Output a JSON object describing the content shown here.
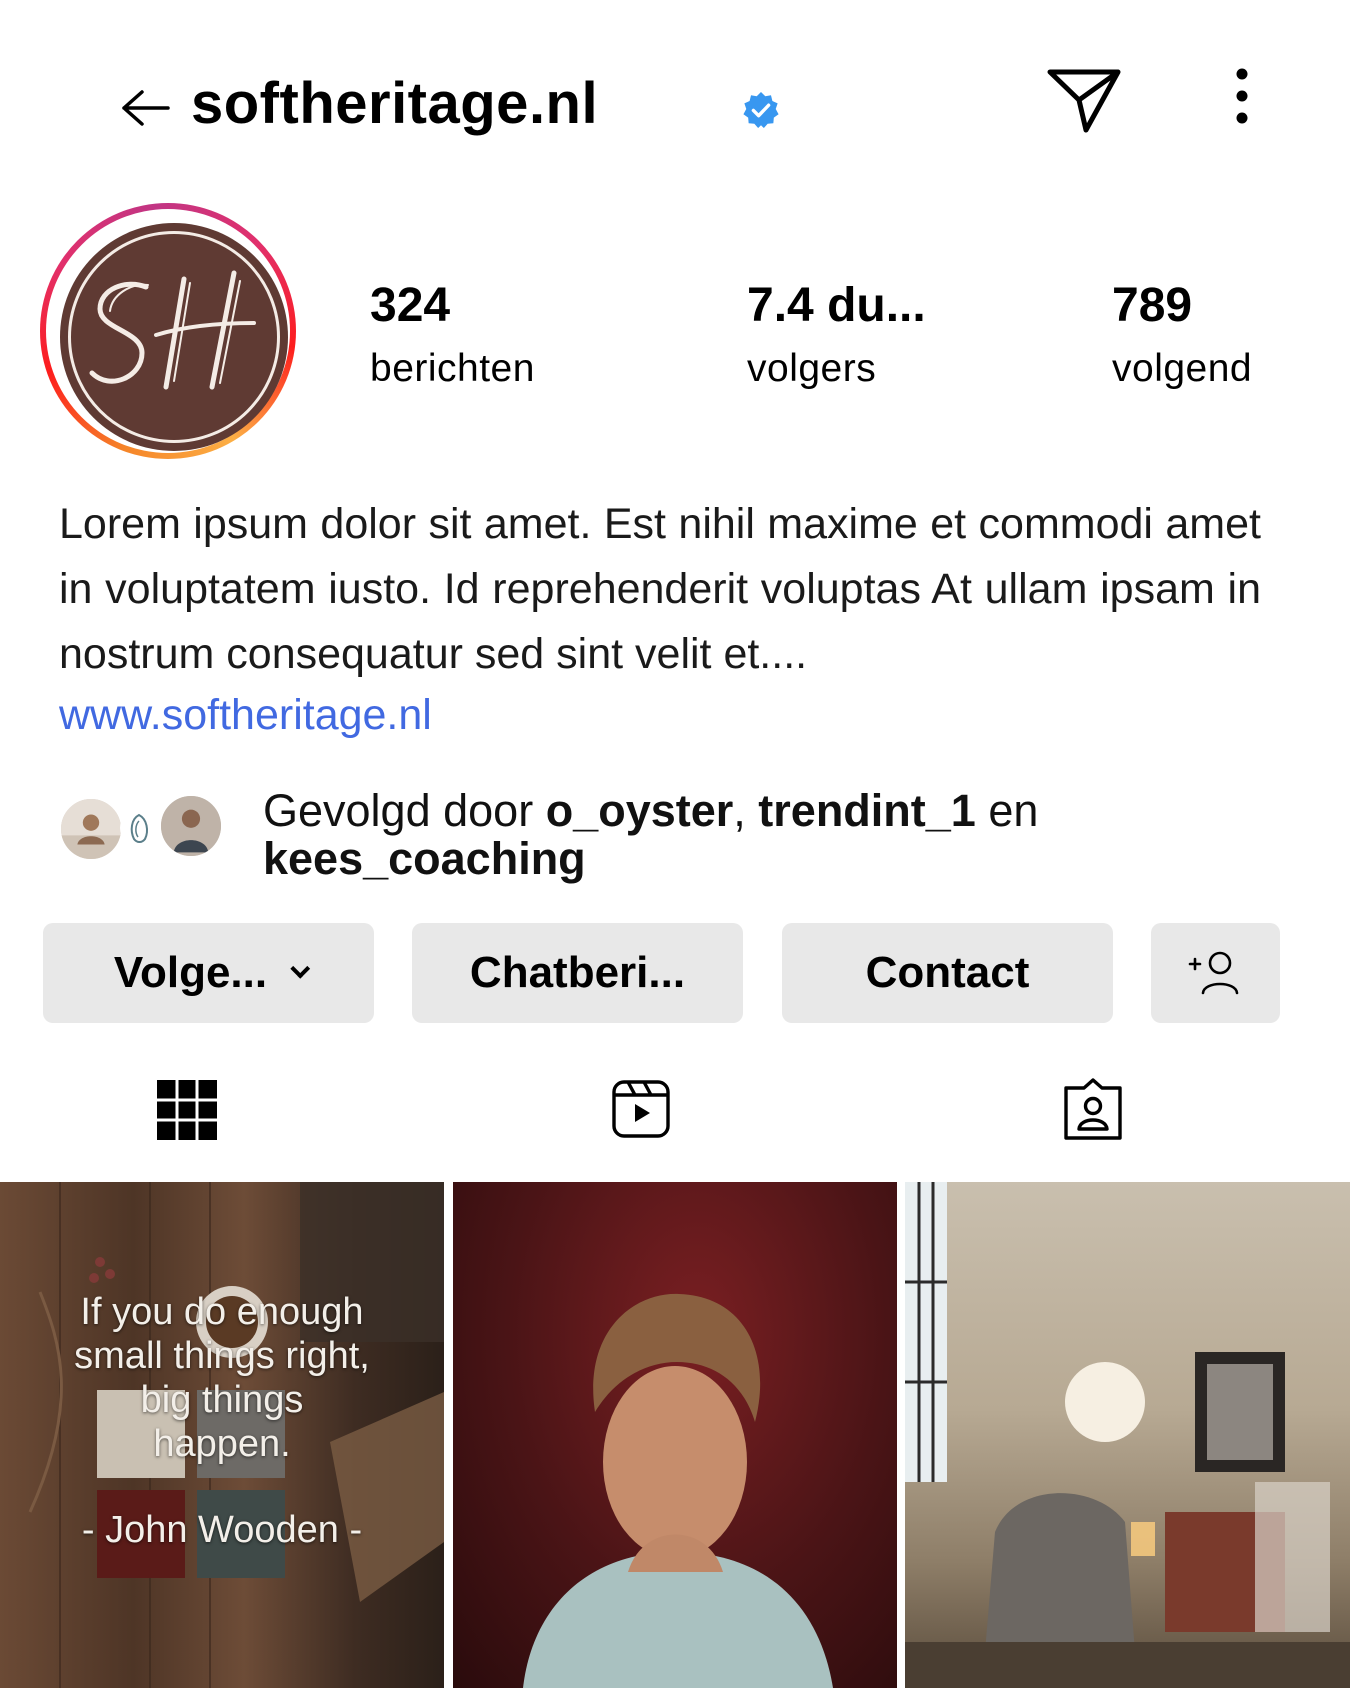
{
  "header": {
    "username": "softheritage.nl",
    "verified": true,
    "back_icon": "arrow-left-icon",
    "send_icon": "paper-plane-icon",
    "more_icon": "more-vertical-icon"
  },
  "profile": {
    "avatar_initials": "SH",
    "stats": [
      {
        "value": "324",
        "label": "berichten"
      },
      {
        "value": "7.4 du...",
        "label": "volgers"
      },
      {
        "value": "789",
        "label": "volgend"
      }
    ],
    "bio": "Lorem ipsum dolor sit amet. Est nihil maxime et commodi amet in voluptatem iusto. Id reprehenderit voluptas At ullam ipsam in nostrum consequatur sed sint velit et....",
    "link": "www.softheritage.nl"
  },
  "followed_by": {
    "prefix": "Gevolgd door ",
    "user1": "o_oyster",
    "sep": ", ",
    "user2": "trendint_1",
    "conj": " en",
    "user3": "kees_coaching"
  },
  "buttons": {
    "follow": "Volge...",
    "chat": "Chatberi...",
    "contact": "Contact",
    "add_person_icon": "add-person-icon"
  },
  "tabs": [
    {
      "name": "grid",
      "icon": "grid-icon",
      "active": true
    },
    {
      "name": "reels",
      "icon": "reels-icon",
      "active": false
    },
    {
      "name": "tagged",
      "icon": "tagged-icon",
      "active": false
    }
  ],
  "posts": {
    "quote_lines": [
      "If you do enough",
      "small things right,",
      "big things",
      "happen."
    ],
    "quote_author": "- John Wooden -"
  },
  "colors": {
    "verified_blue": "#3897f0",
    "link_blue": "#4169e1",
    "button_gray": "#e8e8e8",
    "avatar_brown": "#5f3a33"
  }
}
